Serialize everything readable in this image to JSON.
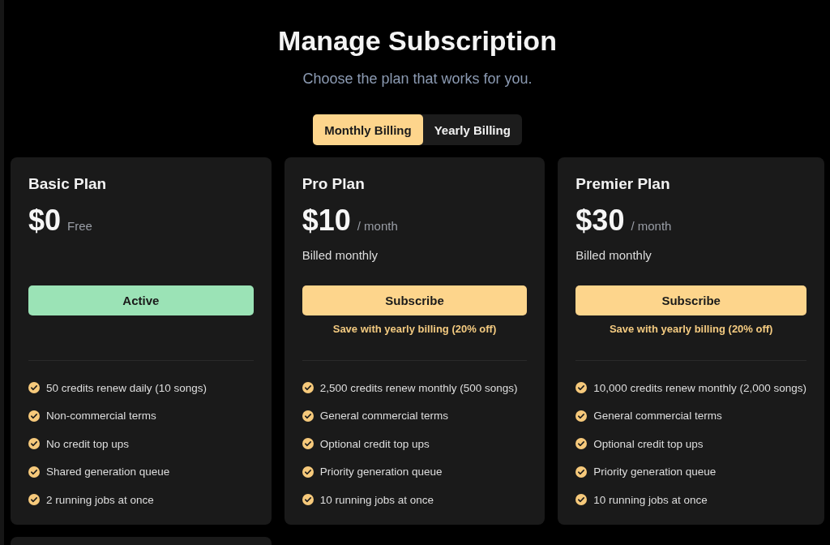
{
  "header": {
    "title": "Manage Subscription",
    "subtitle": "Choose the plan that works for you."
  },
  "billing_toggle": [
    {
      "label": "Monthly Billing",
      "selected": true
    },
    {
      "label": "Yearly Billing",
      "selected": false
    }
  ],
  "plans": [
    {
      "name": "Basic Plan",
      "price": "$0",
      "period": "Free",
      "button": {
        "label": "Active",
        "kind": "active"
      },
      "features": [
        "50 credits renew daily (10 songs)",
        "Non-commercial terms",
        "No credit top ups",
        "Shared generation queue",
        "2 running jobs at once"
      ]
    },
    {
      "name": "Pro Plan",
      "price": "$10",
      "period": "/ month",
      "billing_note": "Billed monthly",
      "button": {
        "label": "Subscribe",
        "kind": "subscribe"
      },
      "savings_note": "Save with yearly billing (20% off)",
      "features": [
        "2,500 credits renew monthly (500 songs)",
        "General commercial terms",
        "Optional credit top ups",
        "Priority generation queue",
        "10 running jobs at once"
      ]
    },
    {
      "name": "Premier Plan",
      "price": "$30",
      "period": "/ month",
      "billing_note": "Billed monthly",
      "button": {
        "label": "Subscribe",
        "kind": "subscribe"
      },
      "savings_note": "Save with yearly billing (20% off)",
      "features": [
        "10,000 credits renew monthly (2,000 songs)",
        "General commercial terms",
        "Optional credit top ups",
        "Priority generation queue",
        "10 running jobs at once"
      ]
    }
  ]
}
